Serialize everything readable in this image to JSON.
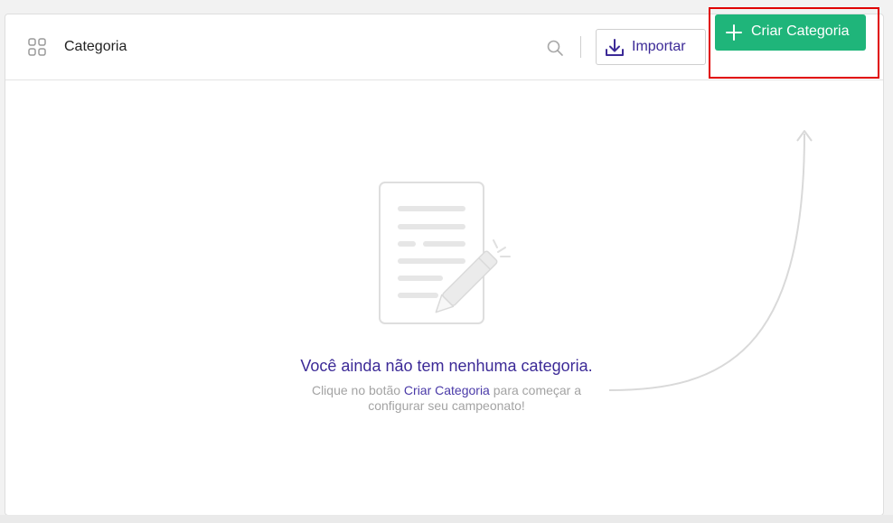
{
  "header": {
    "title": "Categoria",
    "import_label": "Importar",
    "create_label": "Criar Categoria"
  },
  "empty_state": {
    "title": "Você ainda não tem nenhuma categoria.",
    "desc_before": "Clique no botão ",
    "desc_link": "Criar Categoria",
    "desc_after": " para começar a configurar seu campeonato!"
  },
  "icons": [
    "grid-icon",
    "search-icon",
    "download-icon",
    "plus-icon",
    "document-pencil-icon",
    "curved-arrow-icon"
  ],
  "colors": {
    "accent_green": "#1fb57a",
    "accent_purple": "#3c2a97",
    "highlight_red": "#e00000"
  }
}
